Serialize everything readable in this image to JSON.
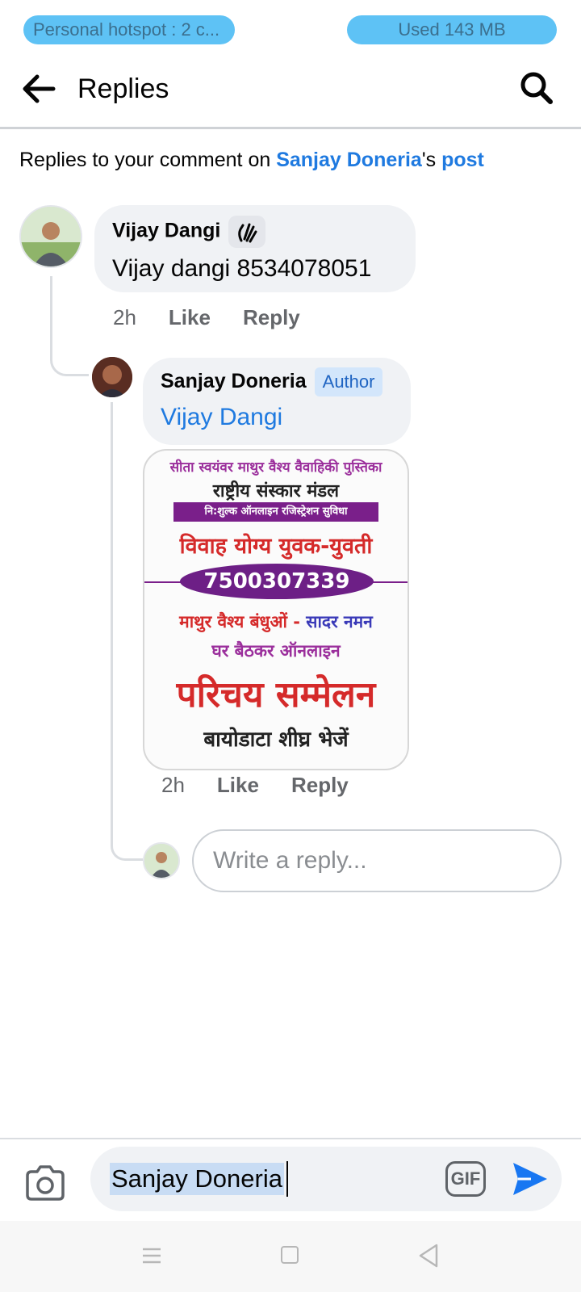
{
  "status_bar": {
    "hotspot": "Personal hotspot : 2 c...",
    "usage": "Used  143 MB"
  },
  "header": {
    "title": "Replies"
  },
  "context": {
    "prefix": "Replies to your comment on ",
    "person": "Sanjay Doneria",
    "possessive": "'s ",
    "post_link": "post"
  },
  "comments": [
    {
      "author": "Vijay Dangi",
      "text": "Vijay dangi 8534078051",
      "time": "2h",
      "like": "Like",
      "reply": "Reply"
    },
    {
      "author": "Sanjay Doneria",
      "badge": "Author",
      "text": "Vijay Dangi",
      "time": "2h",
      "like": "Like",
      "reply": "Reply"
    }
  ],
  "poster": {
    "line1": "सीता स्वयंवर माथुर वैश्य वैवाहिकी पुस्तिका",
    "line2": "राष्ट्रीय संस्कार मंडल",
    "line3": "नि:शुल्क ऑनलाइन रजिस्ट्रेशन सुविधा",
    "line4": "विवाह योग्य युवक-युवती",
    "phone": "7500307339",
    "line5a": "माथुर वैश्य बंधुओं - ",
    "line5b": "सादर नमन",
    "line6": "घर बैठकर ऑनलाइन",
    "line7": "परिचय सम्मेलन",
    "line8": "बायोडाटा शीघ्र भेजें"
  },
  "reply_input": {
    "placeholder": "Write a reply..."
  },
  "composer": {
    "text": "Sanjay Doneria",
    "gif_label": "GIF"
  },
  "colors": {
    "link_blue": "#1f7ae0",
    "bubble_gray": "#f0f2f5",
    "hotspot_pill": "#5ec2f5"
  }
}
